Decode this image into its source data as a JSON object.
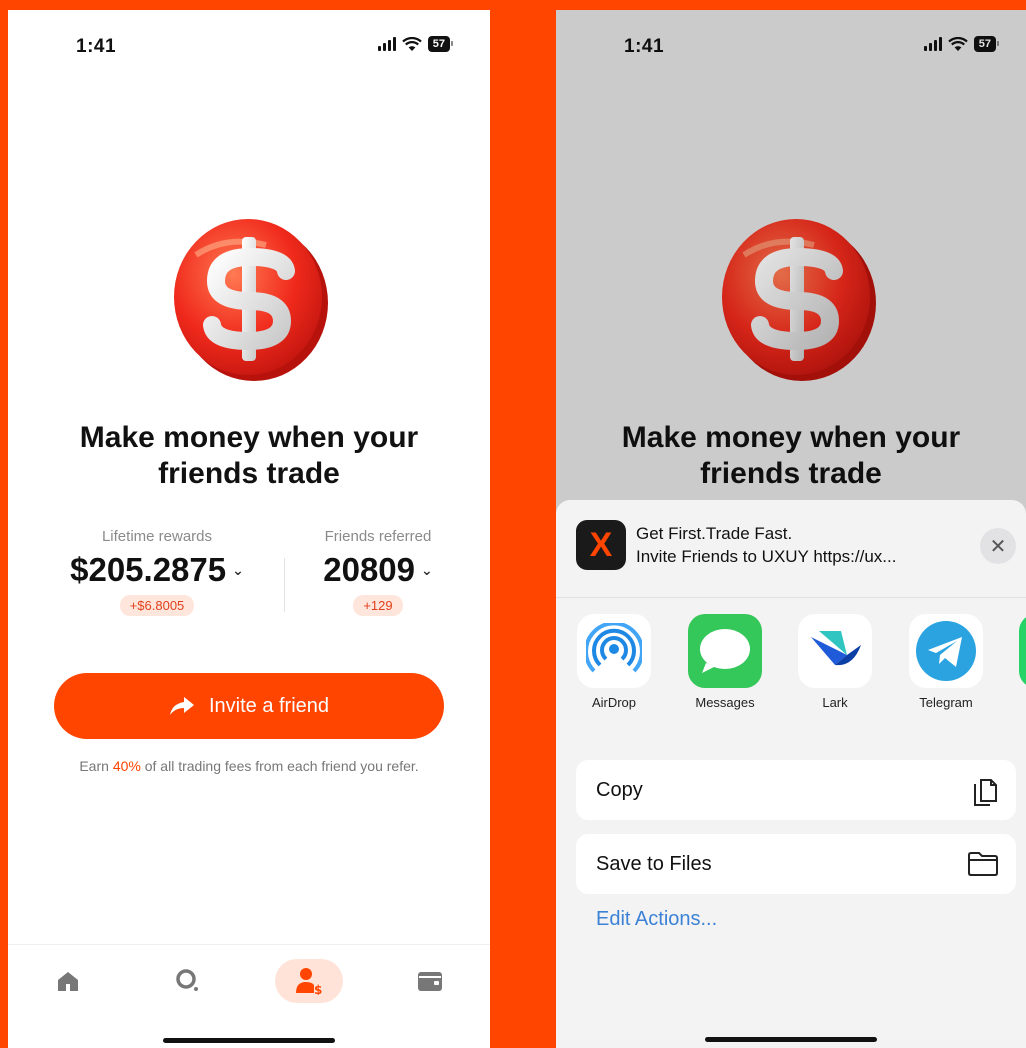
{
  "left_screen": {
    "status": {
      "time": "1:41",
      "battery": "57"
    },
    "headline": {
      "line1": "Make money when your",
      "line2": "friends trade"
    },
    "stats": {
      "lifetime_rewards": {
        "label": "Lifetime rewards",
        "value": "$205.2875",
        "delta": "+$6.8005"
      },
      "friends_referred": {
        "label": "Friends referred",
        "value": "20809",
        "delta": "+129"
      }
    },
    "invite_button": {
      "label": "Invite a friend"
    },
    "earn_note": {
      "before": "Earn ",
      "highlight": "40%",
      "after": " of all trading fees from each friend you refer."
    },
    "tab_bar": {
      "tabs": [
        {
          "icon": "home-icon",
          "active": false
        },
        {
          "icon": "search-icon",
          "active": false
        },
        {
          "icon": "referral-icon",
          "active": true
        },
        {
          "icon": "wallet-icon",
          "active": false
        }
      ]
    }
  },
  "right_screen": {
    "status": {
      "time": "1:41",
      "battery": "57"
    },
    "headline": {
      "line1": "Make money when your",
      "line2": "friends trade"
    },
    "share_sheet": {
      "app_icon_letter": "X",
      "title": "Get First.Trade Fast.",
      "subtitle": "Invite Friends to UXUY https://ux...",
      "targets": [
        {
          "label": "AirDrop",
          "icon": "airdrop-icon"
        },
        {
          "label": "Messages",
          "icon": "messages-icon"
        },
        {
          "label": "Lark",
          "icon": "lark-icon"
        },
        {
          "label": "Telegram",
          "icon": "telegram-icon"
        }
      ],
      "actions": [
        {
          "label": "Copy",
          "icon": "copy-icon"
        },
        {
          "label": "Save to Files",
          "icon": "folder-icon"
        }
      ],
      "edit_actions": "Edit Actions..."
    }
  },
  "colors": {
    "background": "#ff4500",
    "accent": "#ff4500",
    "delta_bg": "#ffe6dc",
    "link_blue": "#3b82d6"
  }
}
